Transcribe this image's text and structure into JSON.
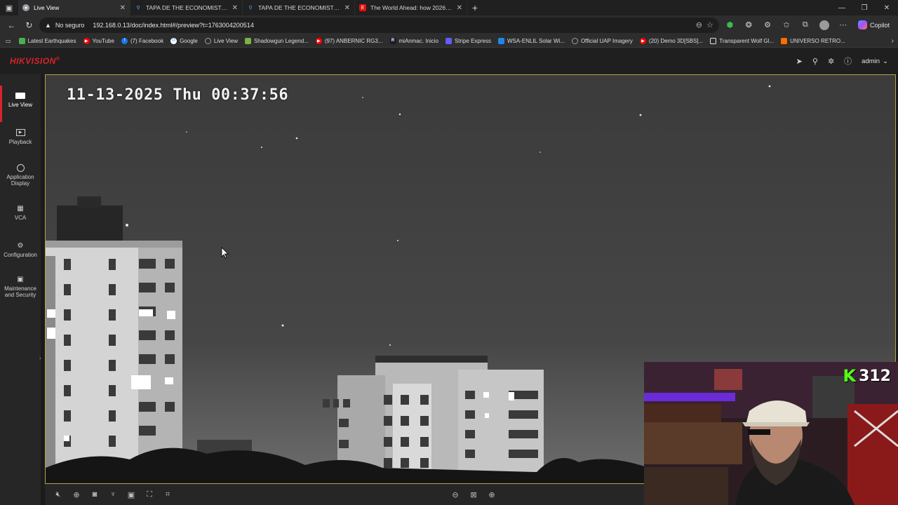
{
  "browser": {
    "tabs": [
      {
        "title": "Live View",
        "active": true,
        "favicon_color": "#9aa0a6"
      },
      {
        "title": "TAPA DE THE ECONOMIST 2026",
        "active": false,
        "favicon_color": "#5aa9ff"
      },
      {
        "title": "TAPA DE THE ECONOMIST 2026",
        "active": false,
        "favicon_color": "#5aa9ff"
      },
      {
        "title": "The World Ahead: how 2026 will",
        "active": false,
        "favicon_color": "#e3120b"
      }
    ],
    "security_label": "No seguro",
    "url": "192.168.0.13/doc/index.html#/preview?t=1763004200514",
    "copilot_label": "Copilot",
    "bookmarks": [
      {
        "label": "Latest Earthquakes",
        "color": "#4caf50"
      },
      {
        "label": "YouTube",
        "color": "#ff0000"
      },
      {
        "label": "(7) Facebook",
        "color": "#1877f2"
      },
      {
        "label": "Google",
        "color": "#ffffff"
      },
      {
        "label": "Live View",
        "color": "#9aa0a6"
      },
      {
        "label": "Shadowgun Legend...",
        "color": "#7cb342"
      },
      {
        "label": "(97) ANBERNIC RG3...",
        "color": "#ff0000"
      },
      {
        "label": "miAnmac. Inicio",
        "color": "#1a1a2e"
      },
      {
        "label": "Stripe Express",
        "color": "#635bff"
      },
      {
        "label": "WSA-ENLIL Solar Wi...",
        "color": "#1e88e5"
      },
      {
        "label": "Official UAP Imagery",
        "color": "#9aa0a6"
      },
      {
        "label": "(20) Demo 3D[SBS]...",
        "color": "#ff0000"
      },
      {
        "label": "Transparent Wolf Gl...",
        "color": "#e0e0e0"
      },
      {
        "label": "UNIVERSO RETRO...",
        "color": "#ff6d00"
      }
    ]
  },
  "app": {
    "brand": "HIKVISION",
    "brand_mark": "®",
    "brand_color": "#d8232a",
    "user": "admin",
    "nav": [
      {
        "label": "Live View",
        "icon": "monitor-icon",
        "active": true
      },
      {
        "label": "Playback",
        "icon": "playback-icon",
        "active": false
      },
      {
        "label": "Application Display",
        "icon": "app-display-icon",
        "active": false
      },
      {
        "label": "VCA",
        "icon": "vca-grid-icon",
        "active": false
      },
      {
        "label": "Configuration",
        "icon": "gear-icon",
        "active": false
      },
      {
        "label": "Maintenance and Security",
        "icon": "maintenance-icon",
        "active": false
      }
    ]
  },
  "video": {
    "osd_timestamp": "11-13-2025 Thu 00:37:56"
  },
  "webcam": {
    "counter": "312",
    "counter_prefix": "K",
    "counter_color": "#53fc18"
  }
}
